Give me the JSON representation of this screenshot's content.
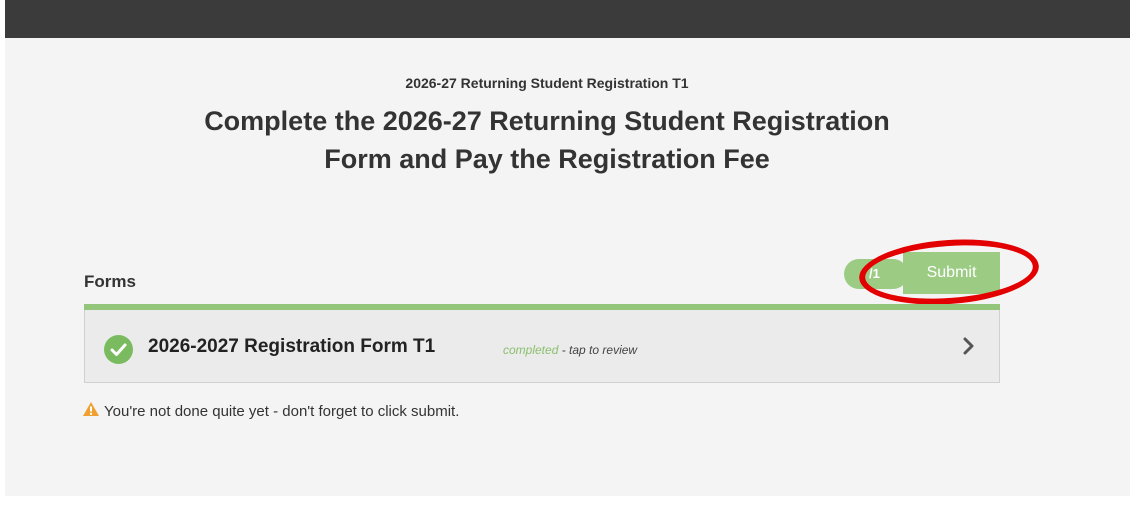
{
  "header": {
    "subtitle": "2026-27 Returning Student Registration T1",
    "title_line1": "Complete the 2026-27 Returning Student Registration",
    "title_line2": "Form and Pay the Registration Fee"
  },
  "forms": {
    "section_label": "Forms",
    "counter": "/1",
    "submit_label": "Submit",
    "items": [
      {
        "name": "2026-2027 Registration Form T1",
        "status": "completed",
        "hint": " - tap to review"
      }
    ]
  },
  "notice": {
    "text": "You're not done quite yet - don't forget to click submit."
  },
  "colors": {
    "accent_green": "#9ccc84",
    "highlight_red": "#e30000",
    "warning_orange": "#f0a030"
  },
  "icons": [
    "check-circle-icon",
    "chevron-right-icon",
    "warning-icon"
  ]
}
